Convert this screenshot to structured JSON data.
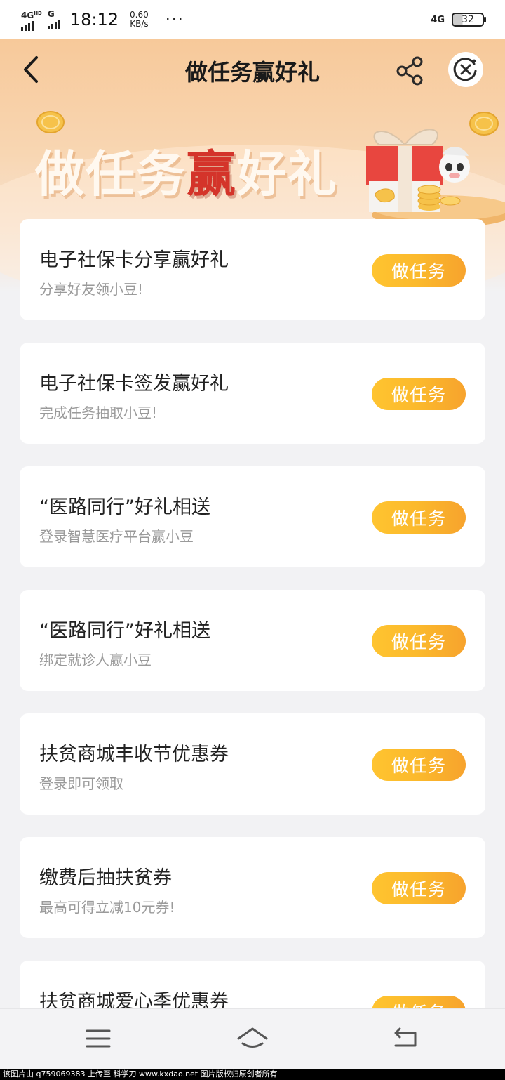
{
  "status_bar": {
    "network_1": "4G",
    "network_1_sup": "HD",
    "network_2": "G",
    "time": "18:12",
    "speed_value": "0.60",
    "speed_unit": "KB/s",
    "more": "···",
    "network_right": "4G",
    "battery": "32"
  },
  "header": {
    "title": "做任务赢好礼",
    "back_icon": "chevron-left-icon",
    "share_icon": "share-icon",
    "close_icon": "close-circle-icon"
  },
  "banner": {
    "text_a": "做任务",
    "text_win": "赢",
    "text_b": "好礼",
    "accent_color": "#d4342a"
  },
  "tasks": [
    {
      "title": "电子社保卡分享赢好礼",
      "subtitle": "分享好友领小豆!",
      "button": "做任务"
    },
    {
      "title": "电子社保卡签发赢好礼",
      "subtitle": "完成任务抽取小豆!",
      "button": "做任务"
    },
    {
      "title": "“医路同行”好礼相送",
      "subtitle": "登录智慧医疗平台赢小豆",
      "button": "做任务"
    },
    {
      "title": "“医路同行”好礼相送",
      "subtitle": "绑定就诊人赢小豆",
      "button": "做任务"
    },
    {
      "title": "扶贫商城丰收节优惠券",
      "subtitle": "登录即可领取",
      "button": "做任务"
    },
    {
      "title": "缴费后抽扶贫券",
      "subtitle": "最高可得立减10元券!",
      "button": "做任务"
    },
    {
      "title": "扶贫商城爱心季优惠券",
      "subtitle": "",
      "button": "做任务"
    }
  ],
  "colors": {
    "button_gradient_start": "#ffc430",
    "button_gradient_end": "#f7a32d",
    "header_bg": "#f7c99a"
  },
  "bottom_nav": {
    "menu_icon": "menu-icon",
    "home_icon": "home-icon",
    "back_icon": "return-icon"
  },
  "watermark": "该图片由 q759069383 上传至 科学刀 www.kxdao.net 图片版权归原创者所有"
}
